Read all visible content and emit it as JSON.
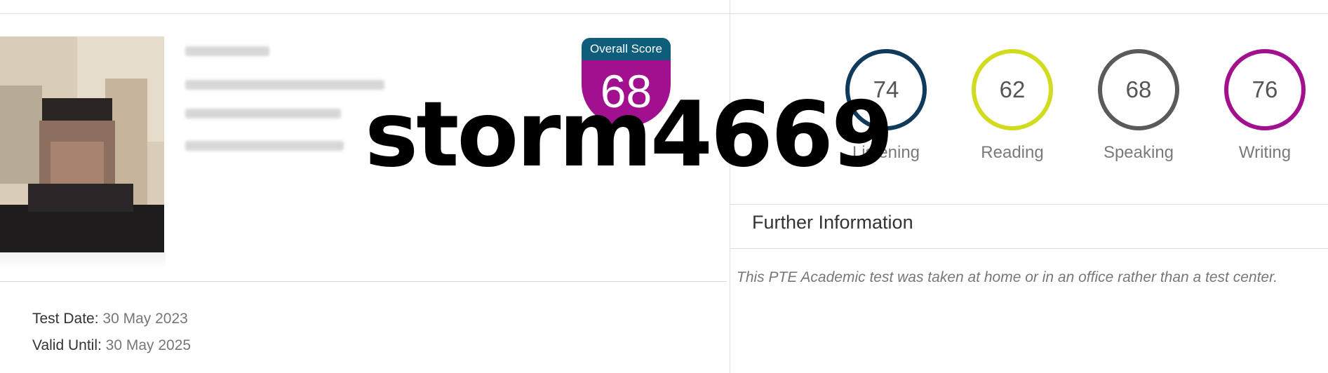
{
  "overall": {
    "header_label": "Overall Score",
    "score": "68",
    "colors": {
      "header": "#0e5d7a",
      "body": "#a1118f"
    }
  },
  "watermark": {
    "text": "storm4669"
  },
  "skills": [
    {
      "label": "Listening",
      "score": "74",
      "color": "#0e3a5c"
    },
    {
      "label": "Reading",
      "score": "62",
      "color": "#d2dc1e"
    },
    {
      "label": "Speaking",
      "score": "68",
      "color": "#5a5a5a"
    },
    {
      "label": "Writing",
      "score": "76",
      "color": "#a1118f"
    }
  ],
  "further_info": {
    "title": "Further Information",
    "note": "This PTE Academic test was taken at home or in an office rather than a test center."
  },
  "test_meta": {
    "test_date_label": "Test Date:",
    "test_date_value": "30 May 2023",
    "valid_until_label": "Valid Until:",
    "valid_until_value": "30 May 2025"
  }
}
